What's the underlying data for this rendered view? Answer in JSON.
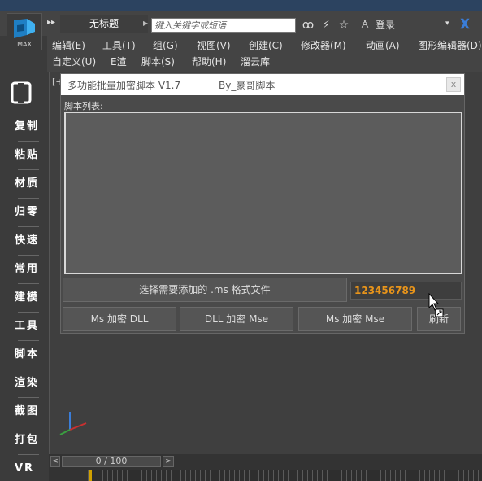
{
  "window": {
    "doc_title": "无标题",
    "search_placeholder": "键入关键字或短语",
    "login_label": "登录",
    "logo_text": "MAX"
  },
  "menu": {
    "row1": [
      "编辑(E)",
      "工具(T)",
      "组(G)",
      "视图(V)",
      "创建(C)",
      "修改器(M)",
      "动画(A)",
      "图形编辑器(D)"
    ],
    "row2": [
      "自定义(U)",
      "E渲",
      "脚本(S)",
      "帮助(H)",
      "溜云库"
    ]
  },
  "sidebar": {
    "items": [
      "复制",
      "粘贴",
      "材质",
      "归零",
      "快速",
      "常用",
      "建模",
      "工具",
      "脚本",
      "渲染",
      "截图",
      "打包",
      "VR"
    ]
  },
  "viewport": {
    "label": "[+"
  },
  "dialog": {
    "title": "多功能批量加密脚本 V1.7",
    "author": "By_豪哥脚本",
    "close": "x",
    "list_label": "脚本列表:",
    "select_button": "选择需要添加的 .ms 格式文件",
    "password_value": "123456789",
    "buttons": [
      "Ms 加密 DLL",
      "DLL 加密 Mse",
      "Ms 加密 Mse",
      "刷新"
    ]
  },
  "timeline": {
    "frame": "0 / 100",
    "prev": "<",
    "next": ">"
  },
  "colors": {
    "accent_orange": "#e8941a",
    "help_blue": "#3a7dd8",
    "top_strip": "#2c4360"
  }
}
